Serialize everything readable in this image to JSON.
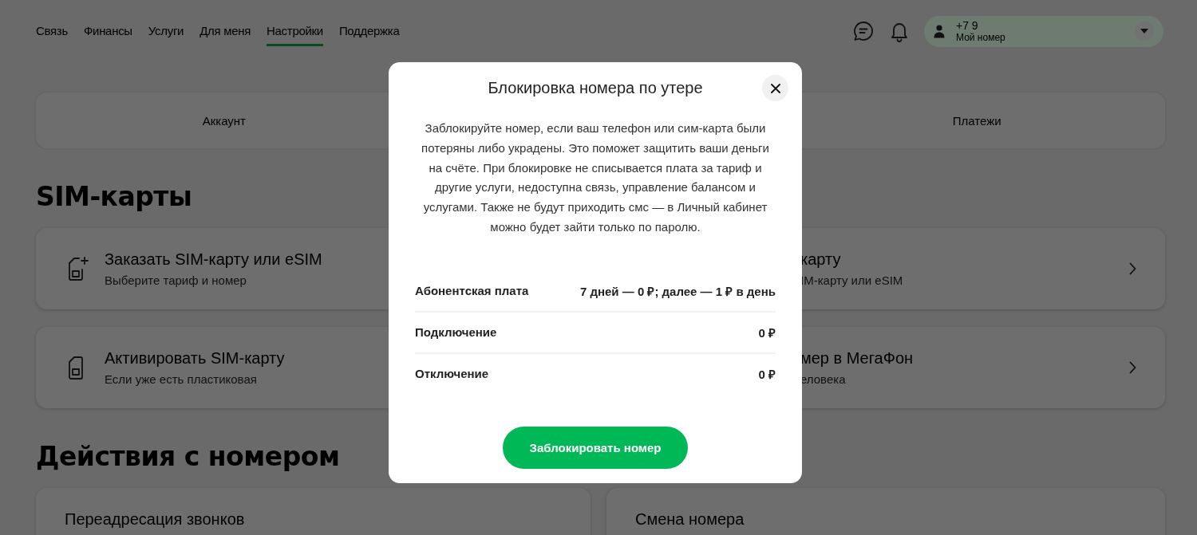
{
  "nav": {
    "items": [
      {
        "label": "Связь",
        "selected": false
      },
      {
        "label": "Финансы",
        "selected": false
      },
      {
        "label": "Услуги",
        "selected": false
      },
      {
        "label": "Для меня",
        "selected": false
      },
      {
        "label": "Настройки",
        "selected": true
      },
      {
        "label": "Поддержка",
        "selected": false
      }
    ]
  },
  "profile": {
    "phone": "+7 9",
    "caption": "Мой номер"
  },
  "segments": [
    {
      "label": "Аккаунт"
    },
    {
      "label": "Платежи"
    }
  ],
  "sim_section": {
    "title": "SIM-карты",
    "cards": [
      {
        "title": "Заказать SIM-карту или eSIM",
        "subtitle": "Выберите тариф и номер",
        "covered": false
      },
      {
        "title": "карту",
        "subtitle": "IM-карту или eSIM",
        "covered": true
      },
      {
        "title": "Активировать SIM-карту",
        "subtitle": "Если уже есть пластиковая",
        "covered": false
      },
      {
        "title": "мер в МегаФон",
        "subtitle": "еловека",
        "covered": true
      }
    ]
  },
  "actions_section": {
    "title": "Действия с номером",
    "cards": [
      {
        "title": "Переадресация звонков"
      },
      {
        "title": "Смена номера"
      }
    ]
  },
  "modal": {
    "title": "Блокировка номера по утере",
    "text": "Заблокируйте номер, если ваш телефон или сим-карта были потеряны либо украдены. Это поможет защитить ваши деньги на счёте. При блокировке не списывается плата за тариф и другие услуги, недоступна связь, управление балансом и услугами. Также не будут приходить смс — в Личный кабинет можно будет зайти только по паролю.",
    "rows": [
      {
        "label": "Абонентская плата",
        "value": "7 дней — 0 ₽; далее — 1 ₽ в день"
      },
      {
        "label": "Подключение",
        "value": "0 ₽"
      },
      {
        "label": "Отключение",
        "value": "0 ₽"
      }
    ],
    "button": "Заблокировать номер"
  }
}
